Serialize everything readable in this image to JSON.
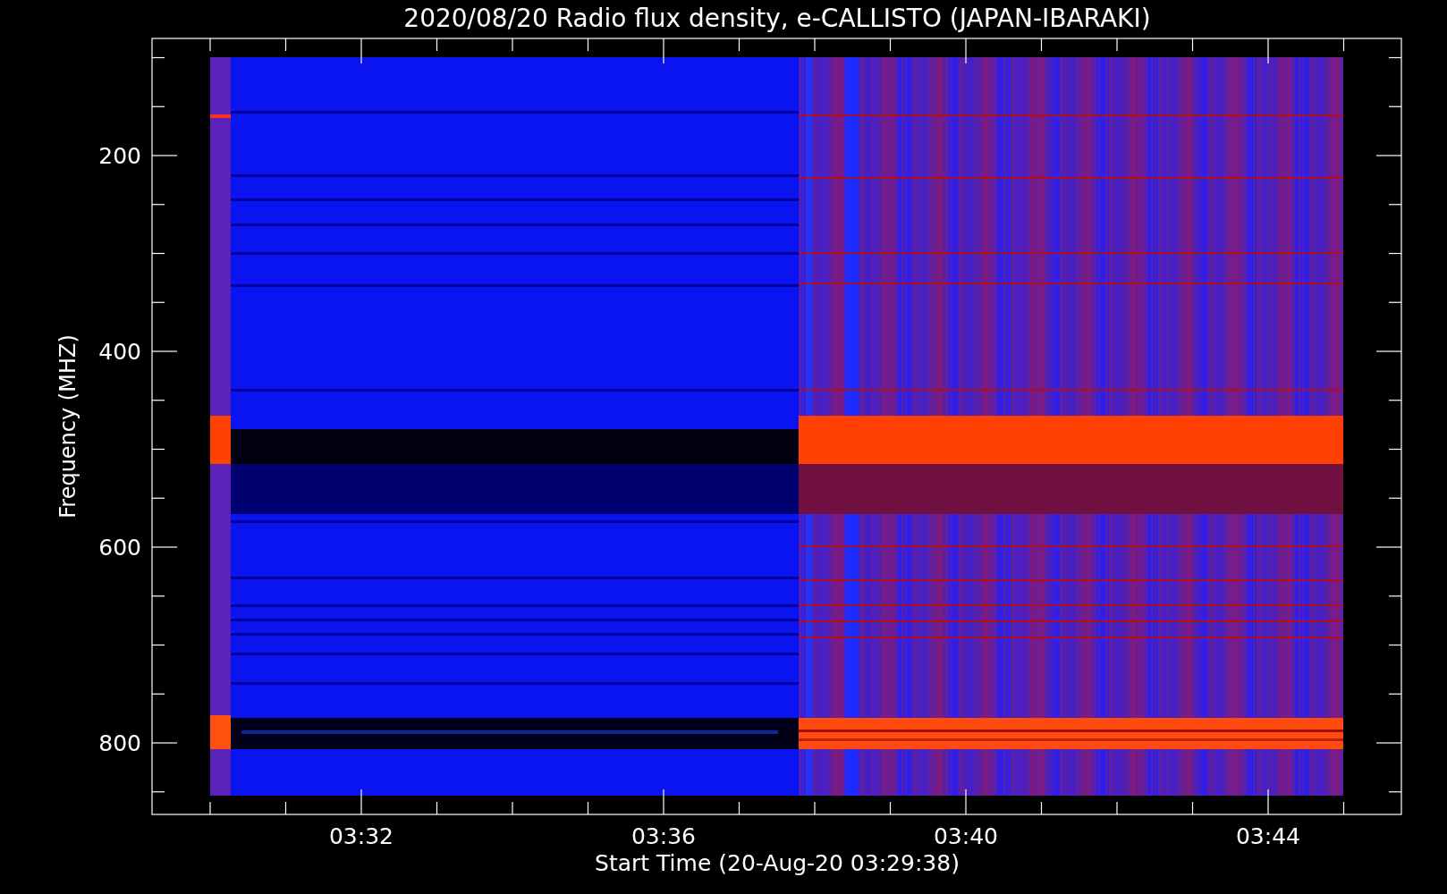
{
  "title": "2020/08/20  Radio flux density, e-CALLISTO (JAPAN-IBARAKI)",
  "ylabel": "Frequency (MHZ)",
  "xlabel": "Start Time (20-Aug-20 03:29:38)",
  "yticks": [
    "200",
    "400",
    "600",
    "800"
  ],
  "xticks": [
    "03:32",
    "03:36",
    "03:40",
    "03:44"
  ]
}
